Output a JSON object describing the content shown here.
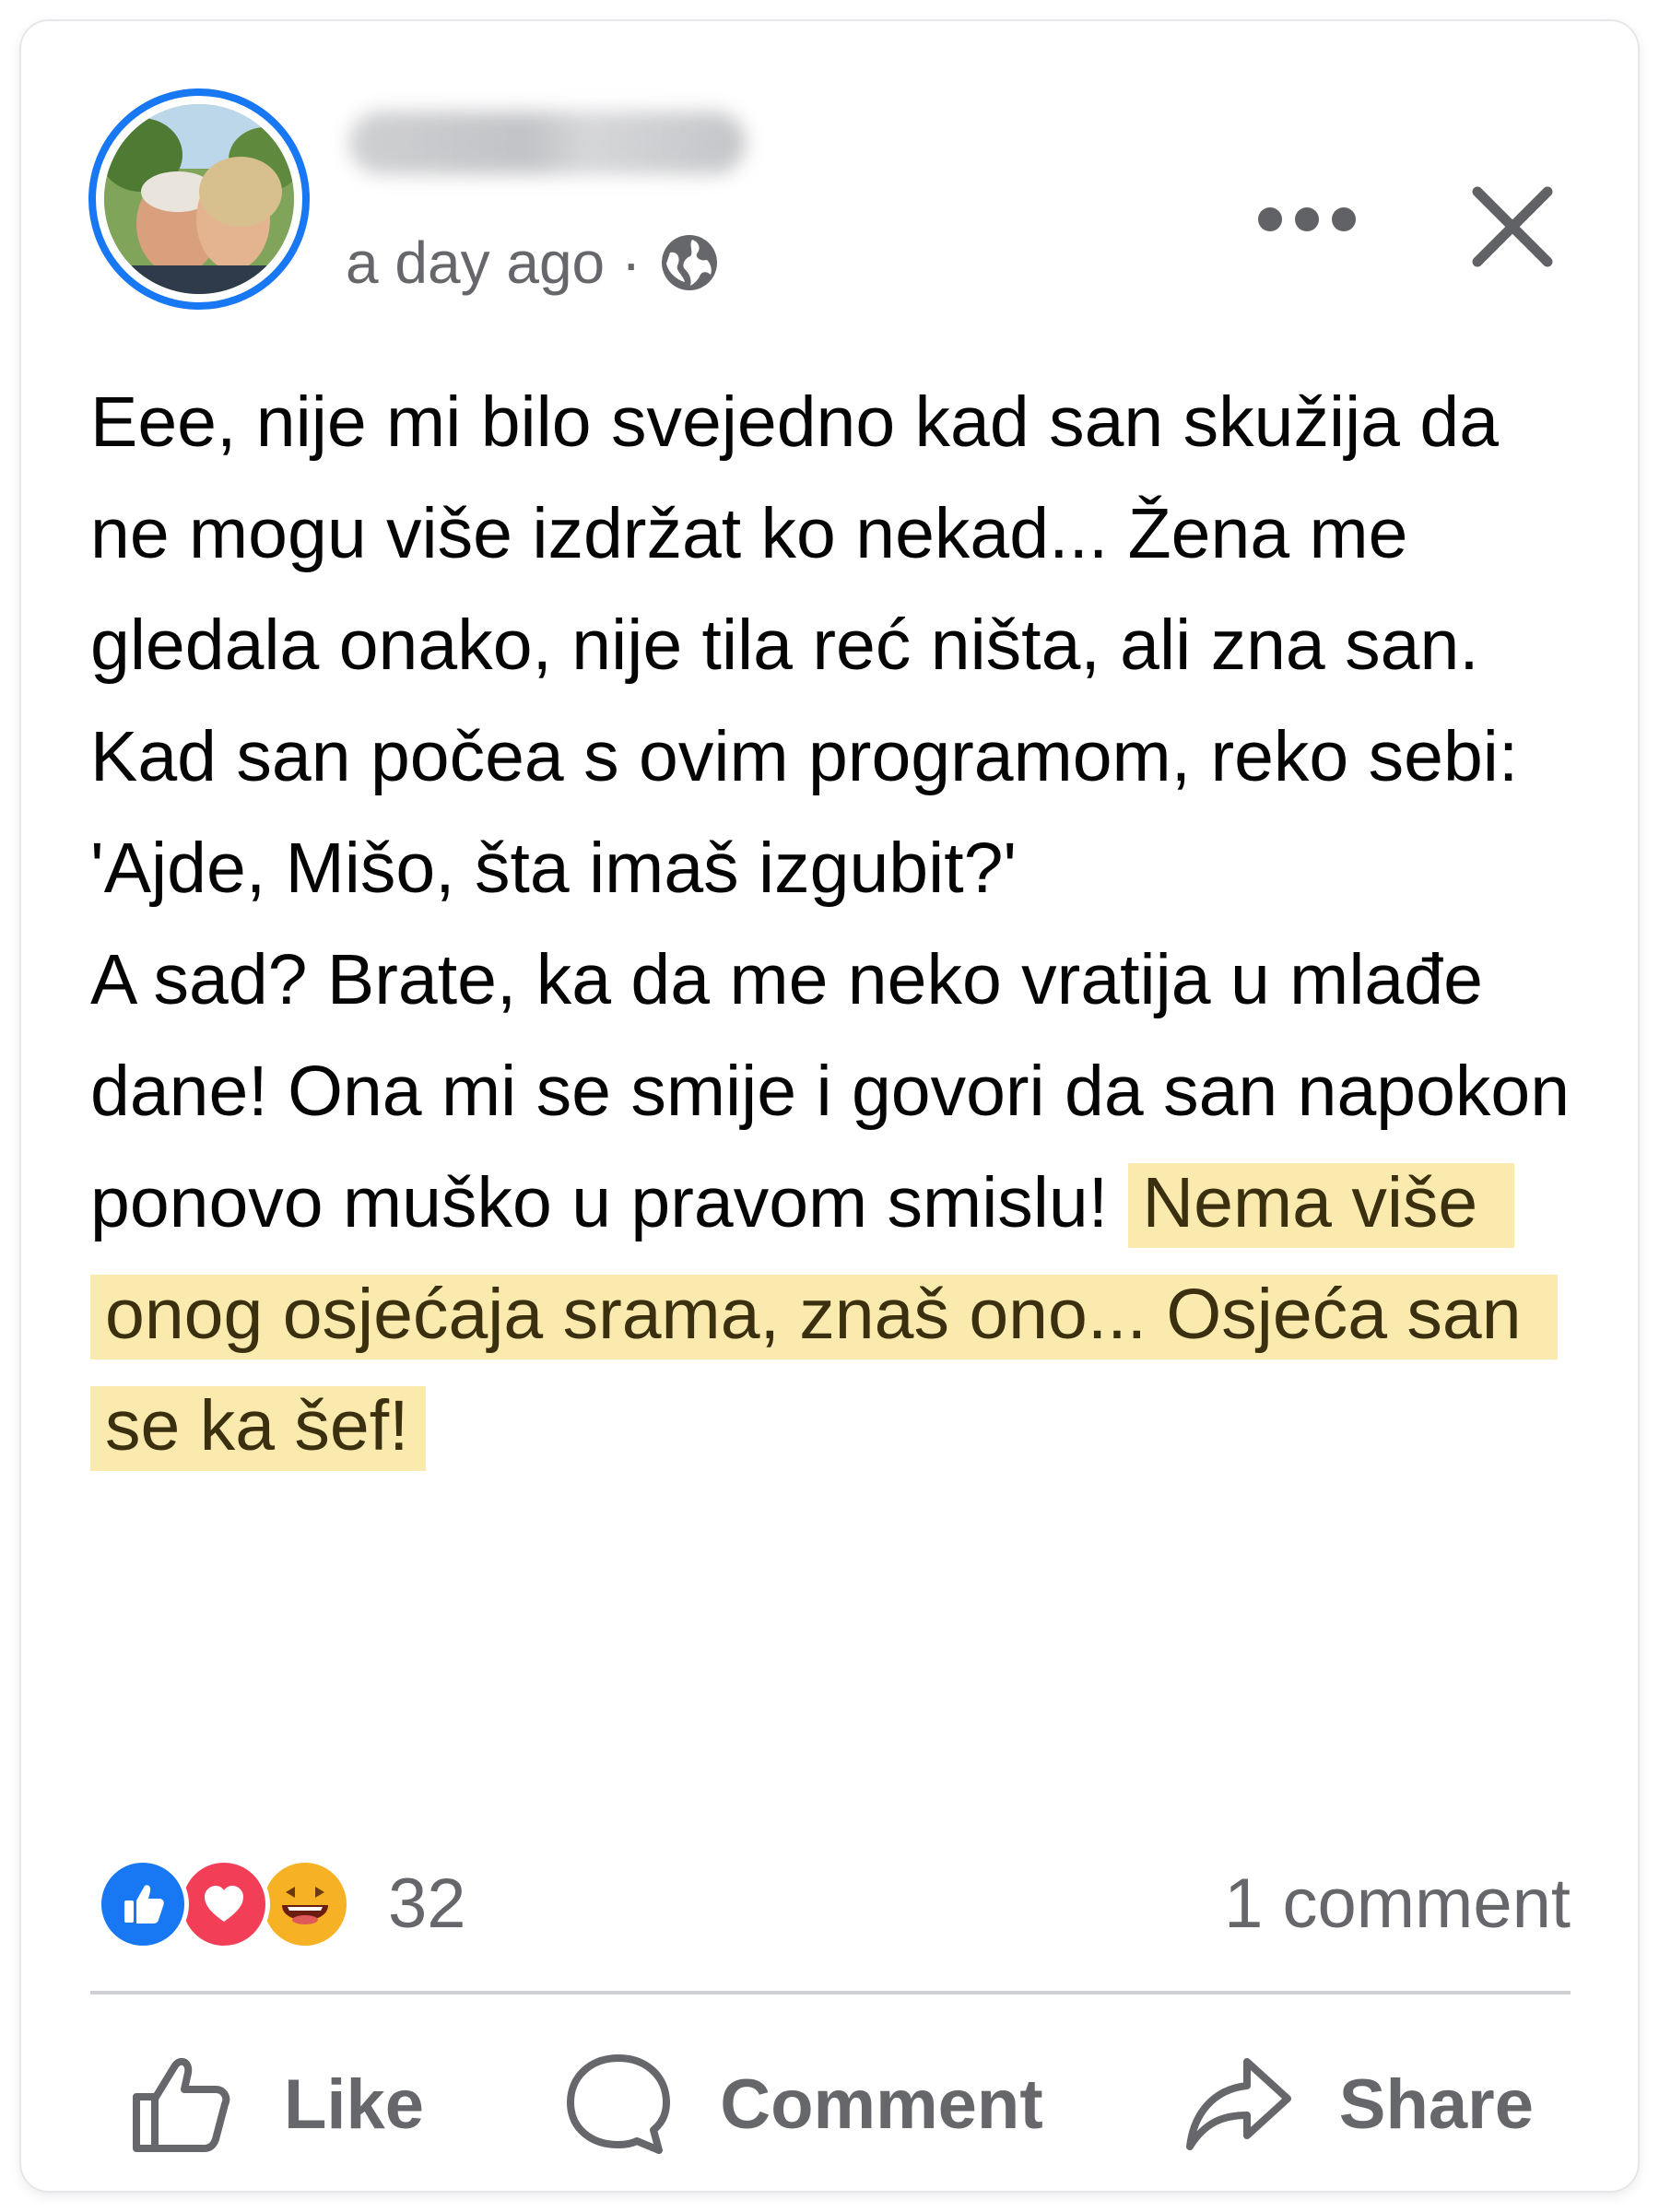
{
  "post": {
    "author_name": "████ ████",
    "timestamp": "a day ago",
    "separator": "·",
    "privacy_icon": "globe-icon",
    "more_icon": "more-options-icon",
    "close_icon": "close-icon",
    "text_plain": "Eee, nije mi bilo svejedno kad san skužija da ne mogu više izdržat ko nekad... Žena me gledala onako, nije tila reć ništa, ali zna san.\nKad san počea s ovim programom, reko sebi:\n'Ajde, Mišo, šta imaš izgubit?'\nA sad? Brate, ka da me neko vratija u mlađe dane! Ona mi se smije i govori da san napokon ponovo muško u pravom smislu! ",
    "text_highlighted": "Nema više onog osjećaja srama, znaš ono... Osjeća san se ka šef!",
    "highlight_color": "#fbeaae"
  },
  "reactions": {
    "icons": [
      "like-reaction-icon",
      "love-reaction-icon",
      "haha-reaction-icon"
    ],
    "count": "32",
    "like_color": "#1877f2",
    "love_color": "#f33e58",
    "haha_color": "#f7b125"
  },
  "comments": {
    "count_label": "1 comment"
  },
  "actions": {
    "like_label": "Like",
    "comment_label": "Comment",
    "share_label": "Share"
  },
  "colors": {
    "accent": "#1877f2",
    "secondary_text": "#65676b",
    "divider": "#ced0d4"
  }
}
